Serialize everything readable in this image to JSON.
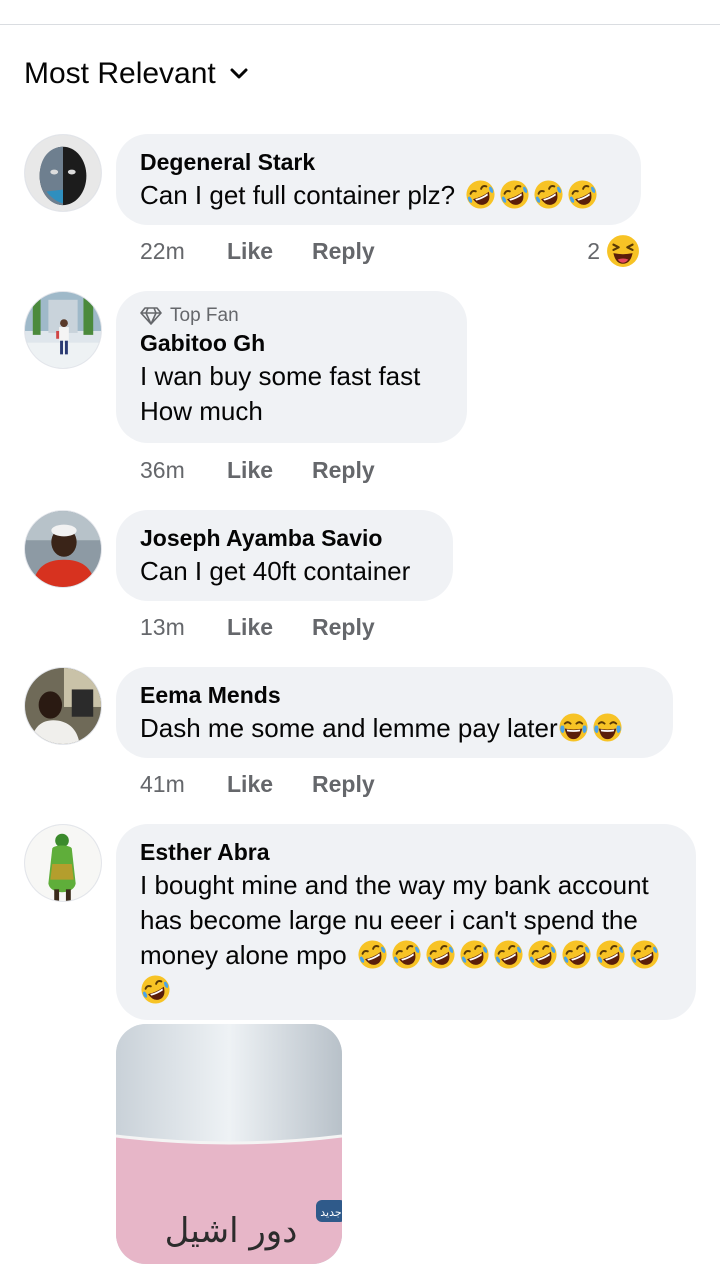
{
  "sort": {
    "label": "Most Relevant",
    "icon": "chevron-down-icon"
  },
  "comments": [
    {
      "name": "Degeneral Stark",
      "text": "Can I get full container plz?",
      "emojis": [
        "rofl",
        "rofl",
        "rofl",
        "rofl"
      ],
      "time": "22m",
      "like": "Like",
      "reply": "Reply",
      "reaction_count": "2",
      "reaction_icon": "laughing-squint-emoji"
    },
    {
      "badge": "Top Fan",
      "badge_icon": "diamond-icon",
      "name": "Gabitoo Gh",
      "text_lines": [
        "I wan buy some fast fast",
        "How much"
      ],
      "time": "36m",
      "like": "Like",
      "reply": "Reply"
    },
    {
      "name": "Joseph Ayamba Savio",
      "text": "Can I get 40ft container",
      "time": "13m",
      "like": "Like",
      "reply": "Reply"
    },
    {
      "name": "Eema Mends",
      "text": "Dash me some and lemme pay later",
      "emojis": [
        "joy",
        "joy"
      ],
      "time": "41m",
      "like": "Like",
      "reply": "Reply"
    },
    {
      "name": "Esther Abra",
      "text_lines": [
        "I bought mine and the way my bank account",
        "has become large nu eeer i can't spend the",
        "money alone mpo"
      ],
      "emojis": [
        "rofl",
        "rofl",
        "rofl",
        "rofl",
        "rofl",
        "rofl",
        "rofl",
        "rofl",
        "rofl",
        "rofl"
      ],
      "attachment_text": "دور اشيل",
      "attachment_badge": "جديد"
    }
  ]
}
